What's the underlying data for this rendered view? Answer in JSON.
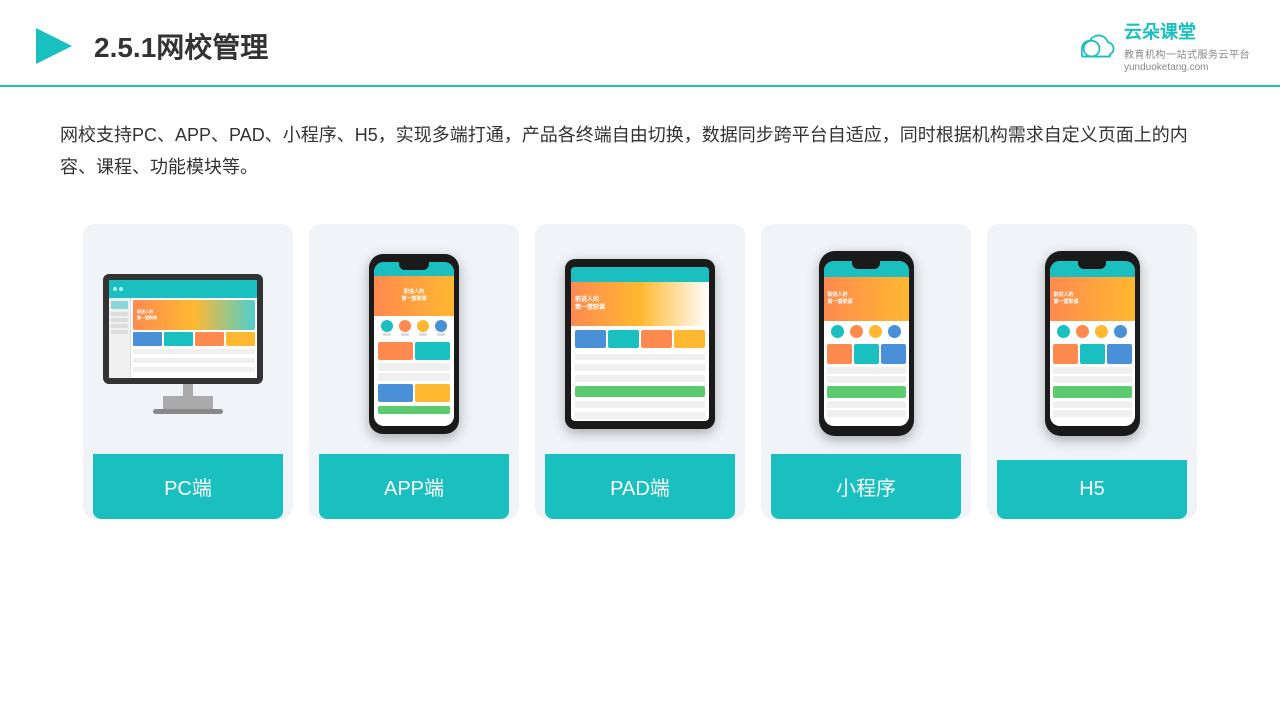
{
  "header": {
    "title": "2.5.1网校管理",
    "brand_name": "云朵课堂",
    "brand_url": "yunduoketang.com",
    "brand_tagline": "教育机构一站式服务云平台"
  },
  "description": {
    "text": "网校支持PC、APP、PAD、小程序、H5，实现多端打通，产品各终端自由切换，数据同步跨平台自适应，同时根据机构需求自定义页面上的内容、课程、功能模块等。"
  },
  "cards": [
    {
      "label": "PC端",
      "type": "pc"
    },
    {
      "label": "APP端",
      "type": "phone"
    },
    {
      "label": "PAD端",
      "type": "tablet"
    },
    {
      "label": "小程序",
      "type": "widephone"
    },
    {
      "label": "H5",
      "type": "widephone2"
    }
  ]
}
